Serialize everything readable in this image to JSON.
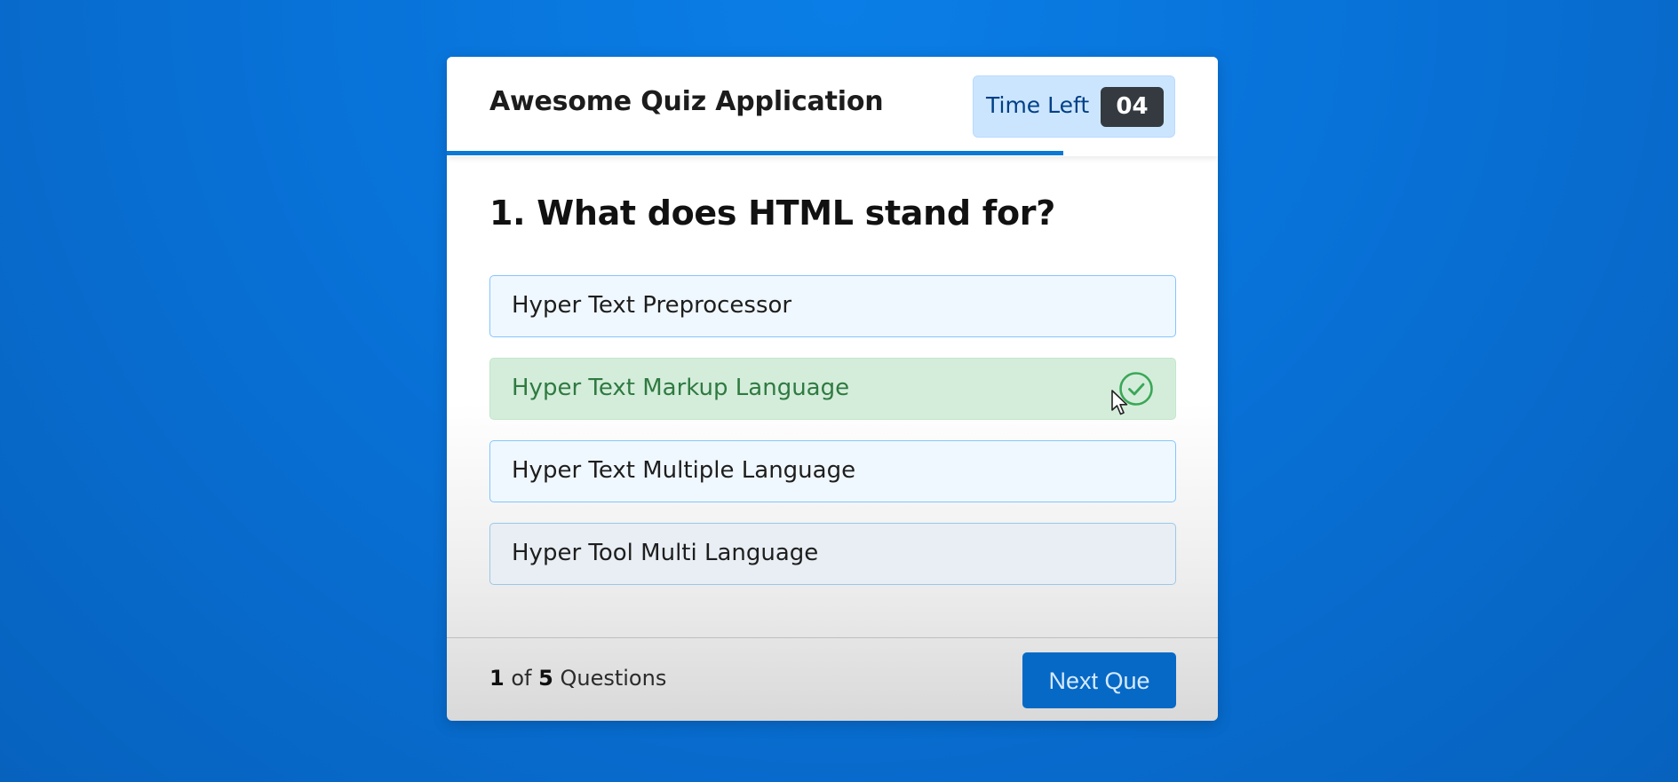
{
  "header": {
    "title": "Awesome Quiz Application",
    "timer_label": "Time Left",
    "timer_value": "04"
  },
  "timer_progress": 0.8,
  "question": {
    "text": "1. What does HTML stand for?"
  },
  "options": [
    {
      "label": "Hyper Text Preprocessor",
      "state": "default"
    },
    {
      "label": "Hyper Text Markup Language",
      "state": "correct",
      "icon": "check-circle-icon"
    },
    {
      "label": "Hyper Text Multiple Language",
      "state": "default"
    },
    {
      "label": "Hyper Tool Multi Language",
      "state": "default"
    }
  ],
  "footer": {
    "current": "1",
    "of_word": "of",
    "total": "5",
    "questions_word": "Questions",
    "next_label": "Next Que"
  },
  "colors": {
    "background": "#0872d8",
    "accent": "#0669c6",
    "correct_bg": "#d4edda",
    "correct_text": "#2f7a41",
    "correct_icon": "#3aa757",
    "option_bg": "#f0f8ff",
    "option_border": "#84c5fe",
    "timer_bg": "#cce5ff",
    "timer_sec_bg": "#343a40"
  }
}
